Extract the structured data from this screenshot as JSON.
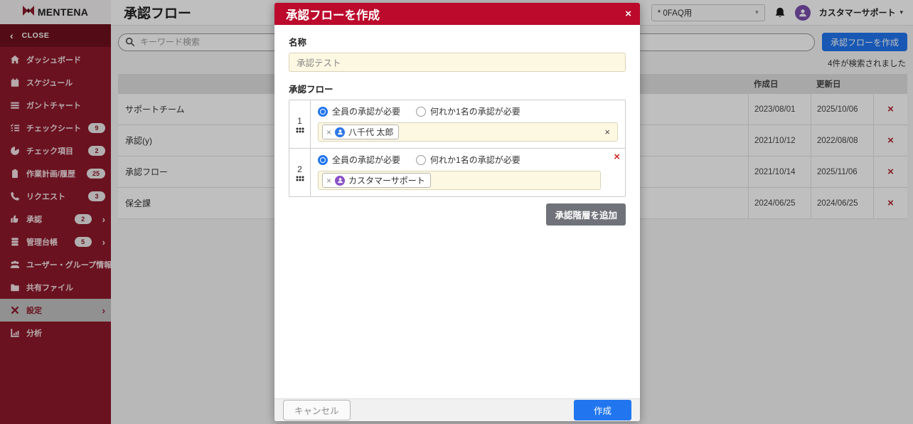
{
  "colors": {
    "sidebar": "#8e182b",
    "sidebar-dark": "#6f111d",
    "modal-red": "#bb0a2c",
    "accent": "#2176f0",
    "delete-red": "#b22330",
    "avatar-purple": "#7b4fae",
    "chip-avatar-blue": "#2e78e6",
    "chip-avatar-purple": "#8a52c6",
    "field-yellow": "#fdf8e2"
  },
  "brand": {
    "name": "MENTENA"
  },
  "sidebar": {
    "close_label": "CLOSE",
    "close_chevron": "‹",
    "chevron": "›",
    "items": [
      {
        "label": "ダッシュボード",
        "icon": "home-icon"
      },
      {
        "label": "スケジュール",
        "icon": "calendar-icon"
      },
      {
        "label": "ガントチャート",
        "icon": "gantt-icon"
      },
      {
        "label": "チェックシート",
        "icon": "checksheet-icon",
        "badge": "9"
      },
      {
        "label": "チェック項目",
        "icon": "check-item-icon",
        "badge": "2"
      },
      {
        "label": "作業計画/履歴",
        "icon": "clipboard-icon",
        "badge": "25"
      },
      {
        "label": "リクエスト",
        "icon": "phone-icon",
        "badge": "3"
      },
      {
        "label": "承認",
        "icon": "thumbs-up-icon",
        "badge": "2",
        "chevron": "›"
      },
      {
        "label": "管理台帳",
        "icon": "database-icon",
        "badge": "5",
        "chevron": "›"
      },
      {
        "label": "ユーザー・グループ情報",
        "icon": "users-icon"
      },
      {
        "label": "共有ファイル",
        "icon": "folder-icon"
      },
      {
        "label": "設定",
        "icon": "tools-icon",
        "chevron": "›",
        "active": true
      },
      {
        "label": "分析",
        "icon": "chart-icon"
      }
    ]
  },
  "header": {
    "page_title": "承認フロー",
    "workspace": "* 0FAQ用",
    "workspace_caret": "▾",
    "user_name": "カスタマーサポート",
    "user_caret": "▾"
  },
  "toolbar": {
    "search_placeholder": "キーワード検索",
    "create_button": "承認フローを作成",
    "result_count": "4件が検索されました"
  },
  "table": {
    "columns": {
      "created": "作成日",
      "updated": "更新日"
    },
    "delete_x": "×",
    "rows": [
      {
        "name": "サポートチーム",
        "created": "2023/08/01",
        "updated": "2025/10/06"
      },
      {
        "name": "承認(y)",
        "created": "2021/10/12",
        "updated": "2022/08/08"
      },
      {
        "name": "承認フロー",
        "created": "2021/10/14",
        "updated": "2025/11/06"
      },
      {
        "name": "保全課",
        "created": "2024/06/25",
        "updated": "2024/06/25"
      }
    ]
  },
  "modal": {
    "title": "承認フローを作成",
    "close_x": "×",
    "name_label": "名称",
    "name_value": "承認テスト",
    "flow_label": "承認フロー",
    "radio_all": "全員の承認が必要",
    "radio_any": "何れか1名の承認が必要",
    "chip_remove_x": "×",
    "clear_x": "×",
    "tier_delete_x": "×",
    "tiers": [
      {
        "index": "1",
        "member": "八千代 太郎"
      },
      {
        "index": "2",
        "member": "カスタマーサポート"
      }
    ],
    "add_tier_button": "承認階層を追加",
    "cancel_button": "キャンセル",
    "submit_button": "作成"
  }
}
